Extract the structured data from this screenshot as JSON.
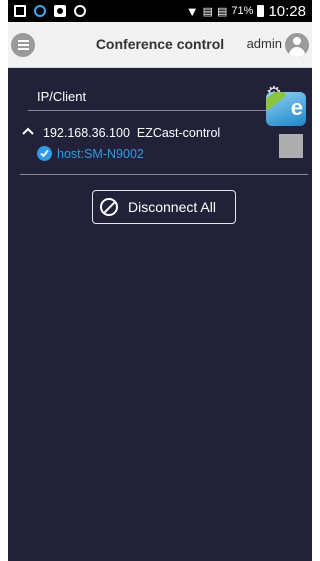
{
  "status_bar": {
    "left_icons": [
      "gallery-icon",
      "circle-icon",
      "app-icon",
      "clock-icon"
    ],
    "right_icons": [
      "wifi-icon",
      "data-icon",
      "data-icon",
      "battery-icon"
    ],
    "battery": "71%",
    "time": "10:28"
  },
  "app_bar": {
    "menu_icon": "menu-icon",
    "title": "Conference control",
    "user": "admin",
    "avatar_icon": "user-icon"
  },
  "list": {
    "column_header": "IP/Client",
    "devices": [
      {
        "ip": "192.168.36.100",
        "name": "EZCast-control",
        "host": "host:SM-N9002",
        "selected": false
      }
    ]
  },
  "actions": {
    "disconnect_all_label": "Disconnect All",
    "disconnect_icon": "prohibit-icon"
  },
  "colors": {
    "background": "#232039",
    "app_bar": "#f2f2f2",
    "accent": "#2f9ae4",
    "checkbox": "#adadad"
  }
}
